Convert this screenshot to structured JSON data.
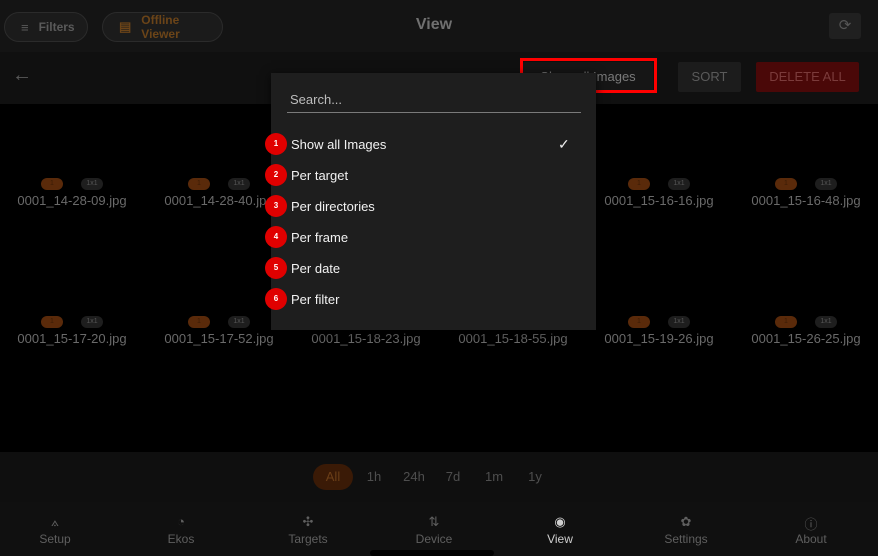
{
  "topbar": {
    "filters_label": "Filters",
    "offline_label": "Offline Viewer",
    "title": "View"
  },
  "toolbar": {
    "filter_button_label": "Show all Images",
    "sort_label": "SORT",
    "delete_all_label": "DELETE ALL"
  },
  "gallery": {
    "badge_1": "1",
    "badge_2": "1x1",
    "items": [
      "0001_14-28-09.jpg",
      "0001_14-28-40.jpg",
      "",
      "",
      "0001_15-16-16.jpg",
      "0001_15-16-48.jpg",
      "0001_15-17-20.jpg",
      "0001_15-17-52.jpg",
      "0001_15-18-23.jpg",
      "0001_15-18-55.jpg",
      "0001_15-19-26.jpg",
      "0001_15-26-25.jpg"
    ]
  },
  "dropdown": {
    "search_placeholder": "Search...",
    "options": [
      {
        "number": "1",
        "label": "Show all Images",
        "selected": true
      },
      {
        "number": "2",
        "label": "Per target",
        "selected": false
      },
      {
        "number": "3",
        "label": "Per directories",
        "selected": false
      },
      {
        "number": "4",
        "label": "Per frame",
        "selected": false
      },
      {
        "number": "5",
        "label": "Per date",
        "selected": false
      },
      {
        "number": "6",
        "label": "Per filter",
        "selected": false
      }
    ]
  },
  "time_ranges": [
    "All",
    "1h",
    "24h",
    "7d",
    "1m",
    "1y"
  ],
  "active_range": "All",
  "bottom_nav": [
    {
      "label": "Setup",
      "icon": "setup-icon"
    },
    {
      "label": "Ekos",
      "icon": "ekos-icon"
    },
    {
      "label": "Targets",
      "icon": "targets-icon"
    },
    {
      "label": "Device",
      "icon": "device-icon"
    },
    {
      "label": "View",
      "icon": "eye-icon"
    },
    {
      "label": "Settings",
      "icon": "gear-icon"
    },
    {
      "label": "About",
      "icon": "info-icon"
    }
  ],
  "active_nav": "View",
  "colors": {
    "accent": "#e65c00",
    "annotation_red": "#ff0000",
    "delete": "#b00000"
  }
}
